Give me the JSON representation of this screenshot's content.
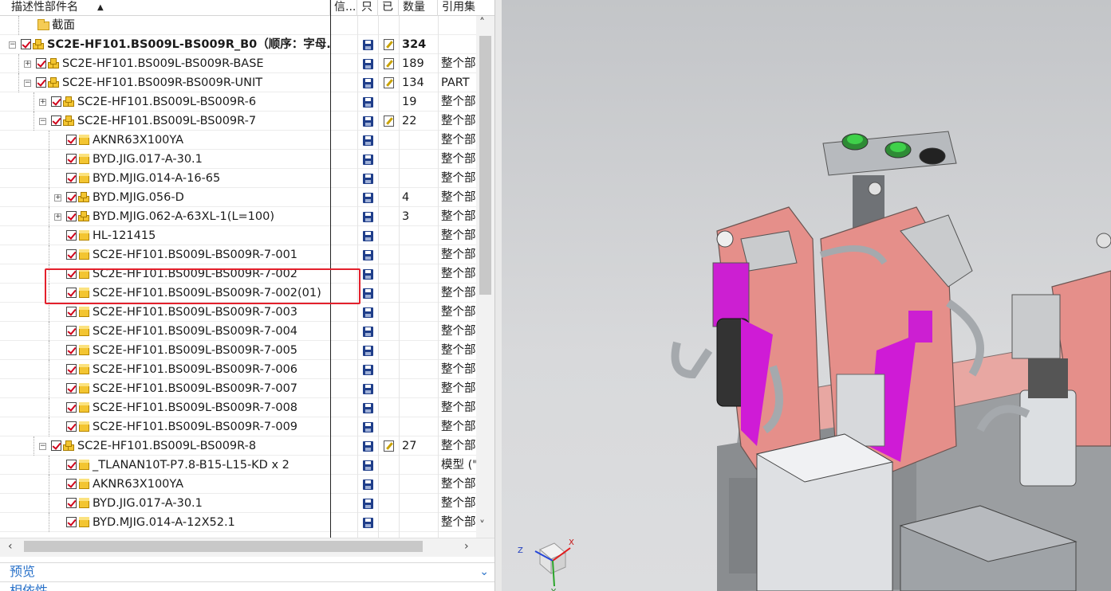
{
  "navigator": {
    "columns": {
      "name": "描述性部件名",
      "info": "信...",
      "saved": "只",
      "modified": "已",
      "quantity": "数量",
      "refset": "引用集"
    },
    "rows": [
      {
        "label": "截面",
        "type": "folder",
        "level": 1,
        "expand": "",
        "check": false,
        "save": false,
        "modified": false,
        "qty": "",
        "ref": "",
        "bold": false
      },
      {
        "label": "SC2E-HF101.BS009L-BS009R_B0（顺序：字母...",
        "type": "assembly",
        "level": 0,
        "expand": "−",
        "check": true,
        "save": true,
        "modified": true,
        "qty": "324",
        "ref": "",
        "bold": true
      },
      {
        "label": "SC2E-HF101.BS009L-BS009R-BASE",
        "type": "assembly",
        "level": 1,
        "expand": "+",
        "check": true,
        "save": true,
        "modified": true,
        "qty": "189",
        "ref": "整个部",
        "bold": false
      },
      {
        "label": "SC2E-HF101.BS009R-BS009R-UNIT",
        "type": "assembly",
        "level": 1,
        "expand": "−",
        "check": true,
        "save": true,
        "modified": true,
        "qty": "134",
        "ref": "PART",
        "bold": false
      },
      {
        "label": "SC2E-HF101.BS009L-BS009R-6",
        "type": "assembly",
        "level": 2,
        "expand": "+",
        "check": true,
        "save": true,
        "modified": false,
        "qty": "19",
        "ref": "整个部",
        "bold": false
      },
      {
        "label": "SC2E-HF101.BS009L-BS009R-7",
        "type": "assembly",
        "level": 2,
        "expand": "−",
        "check": true,
        "save": true,
        "modified": true,
        "qty": "22",
        "ref": "整个部",
        "bold": false
      },
      {
        "label": "AKNR63X100YA",
        "type": "part",
        "level": 3,
        "expand": "",
        "check": true,
        "save": true,
        "modified": false,
        "qty": "",
        "ref": "整个部",
        "bold": false
      },
      {
        "label": "BYD.JIG.017-A-30.1",
        "type": "part",
        "level": 3,
        "expand": "",
        "check": true,
        "save": true,
        "modified": false,
        "qty": "",
        "ref": "整个部",
        "bold": false
      },
      {
        "label": "BYD.MJIG.014-A-16-65",
        "type": "part",
        "level": 3,
        "expand": "",
        "check": true,
        "save": true,
        "modified": false,
        "qty": "",
        "ref": "整个部",
        "bold": false
      },
      {
        "label": "BYD.MJIG.056-D",
        "type": "assembly",
        "level": 3,
        "expand": "+",
        "check": true,
        "save": true,
        "modified": false,
        "qty": "4",
        "ref": "整个部",
        "bold": false
      },
      {
        "label": "BYD.MJIG.062-A-63XL-1(L=100)",
        "type": "assembly",
        "level": 3,
        "expand": "+",
        "check": true,
        "save": true,
        "modified": false,
        "qty": "3",
        "ref": "整个部",
        "bold": false
      },
      {
        "label": "HL-121415",
        "type": "part",
        "level": 3,
        "expand": "",
        "check": true,
        "save": true,
        "modified": false,
        "qty": "",
        "ref": "整个部",
        "bold": false
      },
      {
        "label": "SC2E-HF101.BS009L-BS009R-7-001",
        "type": "part",
        "level": 3,
        "expand": "",
        "check": true,
        "save": true,
        "modified": false,
        "qty": "",
        "ref": "整个部",
        "bold": false
      },
      {
        "label": "SC2E-HF101.BS009L-BS009R-7-002",
        "type": "part",
        "level": 3,
        "expand": "",
        "check": true,
        "save": true,
        "modified": false,
        "qty": "",
        "ref": "整个部",
        "bold": false
      },
      {
        "label": "SC2E-HF101.BS009L-BS009R-7-002(01)",
        "type": "part",
        "level": 3,
        "expand": "",
        "check": true,
        "save": true,
        "modified": false,
        "qty": "",
        "ref": "整个部",
        "bold": false
      },
      {
        "label": "SC2E-HF101.BS009L-BS009R-7-003",
        "type": "part",
        "level": 3,
        "expand": "",
        "check": true,
        "save": true,
        "modified": false,
        "qty": "",
        "ref": "整个部",
        "bold": false
      },
      {
        "label": "SC2E-HF101.BS009L-BS009R-7-004",
        "type": "part",
        "level": 3,
        "expand": "",
        "check": true,
        "save": true,
        "modified": false,
        "qty": "",
        "ref": "整个部",
        "bold": false
      },
      {
        "label": "SC2E-HF101.BS009L-BS009R-7-005",
        "type": "part",
        "level": 3,
        "expand": "",
        "check": true,
        "save": true,
        "modified": false,
        "qty": "",
        "ref": "整个部",
        "bold": false
      },
      {
        "label": "SC2E-HF101.BS009L-BS009R-7-006",
        "type": "part",
        "level": 3,
        "expand": "",
        "check": true,
        "save": true,
        "modified": false,
        "qty": "",
        "ref": "整个部",
        "bold": false
      },
      {
        "label": "SC2E-HF101.BS009L-BS009R-7-007",
        "type": "part",
        "level": 3,
        "expand": "",
        "check": true,
        "save": true,
        "modified": false,
        "qty": "",
        "ref": "整个部",
        "bold": false
      },
      {
        "label": "SC2E-HF101.BS009L-BS009R-7-008",
        "type": "part",
        "level": 3,
        "expand": "",
        "check": true,
        "save": true,
        "modified": false,
        "qty": "",
        "ref": "整个部",
        "bold": false
      },
      {
        "label": "SC2E-HF101.BS009L-BS009R-7-009",
        "type": "part",
        "level": 3,
        "expand": "",
        "check": true,
        "save": true,
        "modified": false,
        "qty": "",
        "ref": "整个部",
        "bold": false
      },
      {
        "label": "SC2E-HF101.BS009L-BS009R-8",
        "type": "assembly",
        "level": 2,
        "expand": "−",
        "check": true,
        "save": true,
        "modified": true,
        "qty": "27",
        "ref": "整个部",
        "bold": false
      },
      {
        "label": "_TLANAN10T-P7.8-B15-L15-KD x 2",
        "type": "part",
        "level": 3,
        "expand": "",
        "check": true,
        "save": true,
        "modified": false,
        "qty": "",
        "ref": "模型 (\"",
        "bold": false
      },
      {
        "label": "AKNR63X100YA",
        "type": "part",
        "level": 3,
        "expand": "",
        "check": true,
        "save": true,
        "modified": false,
        "qty": "",
        "ref": "整个部",
        "bold": false
      },
      {
        "label": "BYD.JIG.017-A-30.1",
        "type": "part",
        "level": 3,
        "expand": "",
        "check": true,
        "save": true,
        "modified": false,
        "qty": "",
        "ref": "整个部",
        "bold": false
      },
      {
        "label": "BYD.MJIG.014-A-12X52.1",
        "type": "part",
        "level": 3,
        "expand": "",
        "check": true,
        "save": true,
        "modified": false,
        "qty": "",
        "ref": "整个部",
        "bold": false
      }
    ],
    "sections": {
      "preview": "预览",
      "dependency": "相依性"
    },
    "highlight_color": "#e4202c"
  },
  "viewport": {
    "axis_labels": {
      "x": "X",
      "y": "Y",
      "z": "Z"
    },
    "colors": {
      "plate": "#e58f8a",
      "highlight_part": "#d51ad8",
      "metal": "#b9bcbf",
      "background": "#cfd0d2"
    }
  }
}
